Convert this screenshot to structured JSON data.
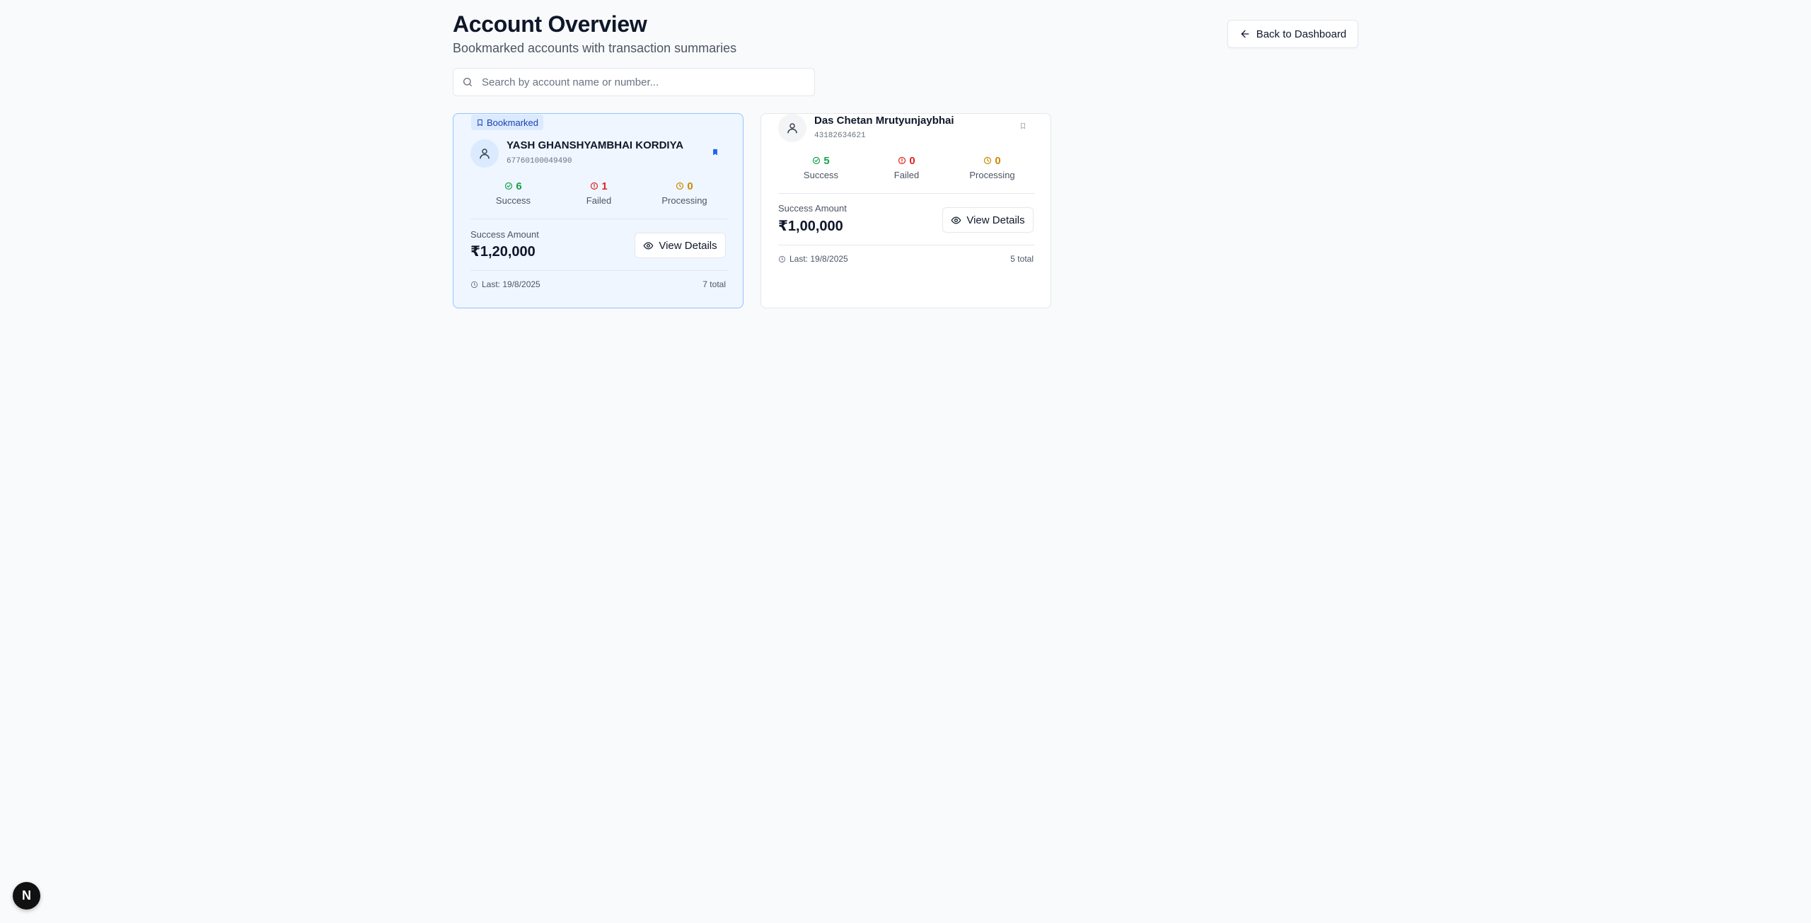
{
  "header": {
    "title": "Account Overview",
    "subtitle": "Bookmarked accounts with transaction summaries",
    "back_label": "Back to Dashboard"
  },
  "search": {
    "placeholder": "Search by account name or number...",
    "value": ""
  },
  "accounts": [
    {
      "bookmarked": true,
      "badge_label": "Bookmarked",
      "name": "YASH GHANSHYAMBHAI KORDIYA",
      "number": "67760100049490",
      "stats": {
        "success": {
          "value": "6",
          "label": "Success"
        },
        "failed": {
          "value": "1",
          "label": "Failed"
        },
        "processing": {
          "value": "0",
          "label": "Processing"
        }
      },
      "amount_label": "Success Amount",
      "amount": "₹1,20,000",
      "view_label": "View Details",
      "last": "Last: 19/8/2025",
      "total": "7 total"
    },
    {
      "bookmarked": false,
      "name": "Das Chetan Mrutyunjaybhai",
      "number": "43182634621",
      "stats": {
        "success": {
          "value": "5",
          "label": "Success"
        },
        "failed": {
          "value": "0",
          "label": "Failed"
        },
        "processing": {
          "value": "0",
          "label": "Processing"
        }
      },
      "amount_label": "Success Amount",
      "amount": "₹1,00,000",
      "view_label": "View Details",
      "last": "Last: 19/8/2025",
      "total": "5 total"
    }
  ],
  "dev_badge": {
    "label": "N"
  },
  "colors": {
    "bookmarked_card_bg": "#eff6ff",
    "bookmarked_card_border": "#93c5fd",
    "success": "#16a34a",
    "failed": "#dc2626",
    "processing": "#ca8a04"
  }
}
